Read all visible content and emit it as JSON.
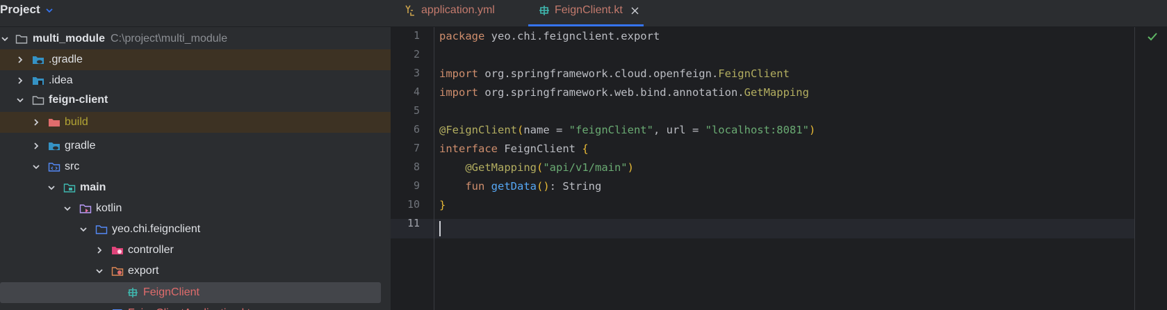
{
  "project_panel": {
    "title": "Project",
    "tree": [
      {
        "label": "multi_module",
        "path": "C:\\project\\multi_module"
      },
      {
        "label": ".gradle"
      },
      {
        "label": ".idea"
      },
      {
        "label": "feign-client"
      },
      {
        "label": "build"
      },
      {
        "label": "gradle"
      },
      {
        "label": "src"
      },
      {
        "label": "main"
      },
      {
        "label": "kotlin"
      },
      {
        "label": "yeo.chi.feignclient"
      },
      {
        "label": "controller"
      },
      {
        "label": "export"
      },
      {
        "label": "FeignClient"
      },
      {
        "label": "FeignClientApplication.kt"
      }
    ]
  },
  "editor": {
    "tabs": [
      {
        "label": "application.yml"
      },
      {
        "label": "FeignClient.kt"
      }
    ],
    "line_numbers": [
      "1",
      "2",
      "3",
      "4",
      "5",
      "6",
      "7",
      "8",
      "9",
      "10",
      "11"
    ],
    "current_line": 11,
    "code": {
      "l1_kw": "package",
      "l1_rest": " yeo.chi.feignclient.export",
      "l3_kw": "import",
      "l3_pkg": " org.springframework.cloud.openfeign.",
      "l3_cls": "FeignClient",
      "l4_kw": "import",
      "l4_pkg": " org.springframework.web.bind.annotation.",
      "l4_cls": "GetMapping",
      "l6_ann": "@FeignClient",
      "l6_open": "(",
      "l6_a": "name = ",
      "l6_s1": "\"feignClient\"",
      "l6_b": ", url = ",
      "l6_s2": "\"localhost:8081\"",
      "l6_close": ")",
      "l7_kw": "interface",
      "l7_name": " FeignClient ",
      "l7_brace": "{",
      "l8_indent": "    ",
      "l8_ann": "@GetMapping",
      "l8_open": "(",
      "l8_str": "\"api/v1/main\"",
      "l8_close": ")",
      "l9_indent": "    ",
      "l9_kw": "fun",
      "l9_sp": " ",
      "l9_fn": "getData",
      "l9_parens": "()",
      "l9_rest": ": String",
      "l10_brace": "}"
    }
  },
  "colors": {
    "background": "#1e1f22",
    "panel": "#2b2d30",
    "accent": "#3574f0",
    "excluded_row": "#3d3223",
    "selected_row": "#43454a"
  },
  "icons": [
    "chevron-down-icon",
    "chevron-right-icon",
    "folder-icon",
    "excluded-folder-icon",
    "source-folder-icon",
    "kotlin-folder-icon",
    "yaml-file-icon",
    "kotlin-interface-icon",
    "close-icon",
    "check-icon"
  ]
}
